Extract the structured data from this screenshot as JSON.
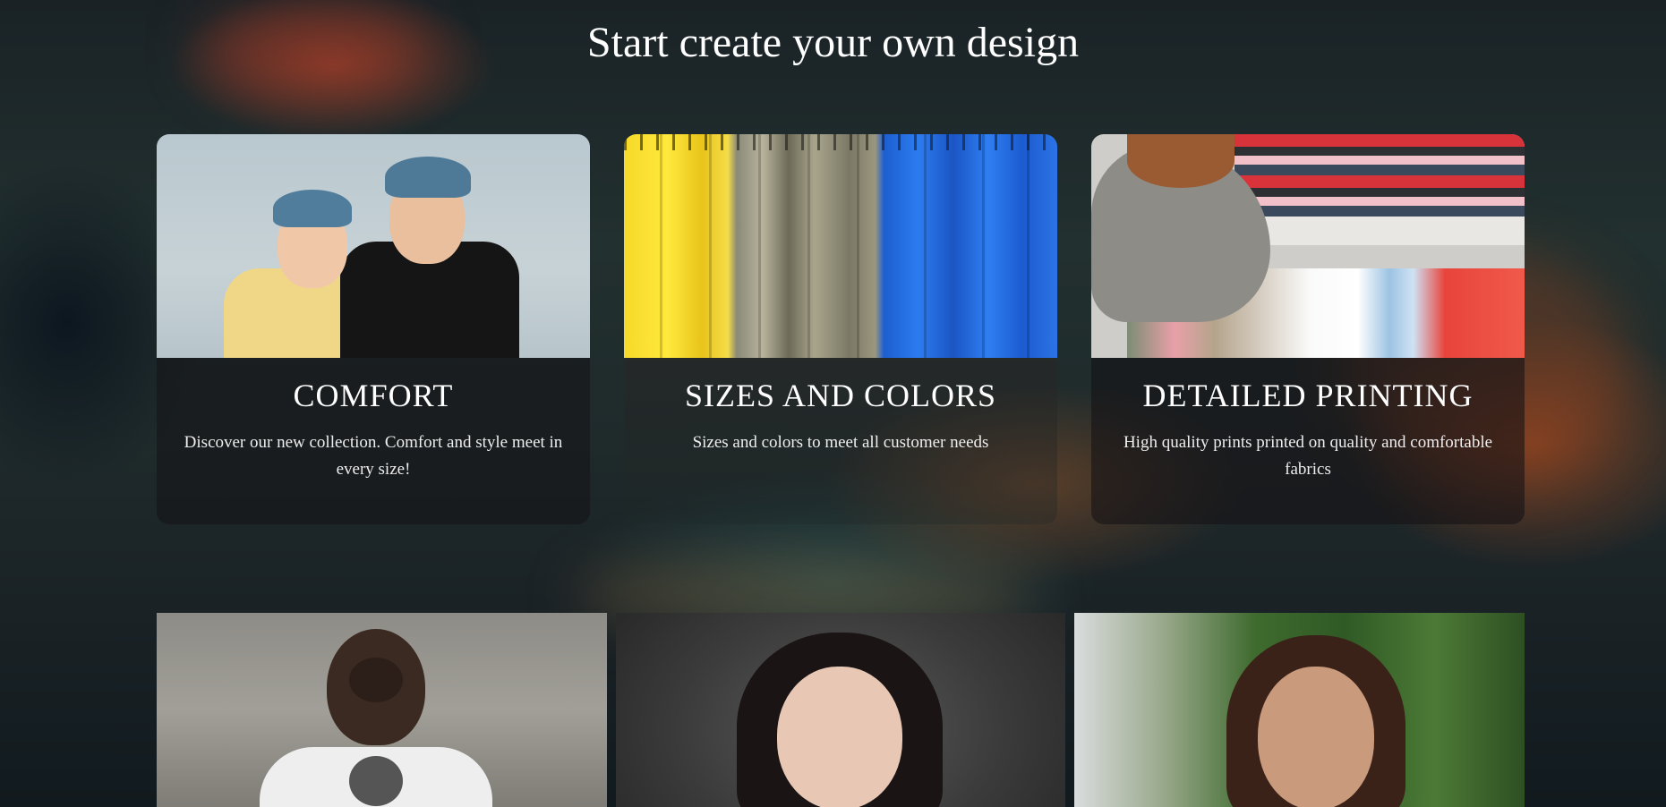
{
  "page": {
    "title": "Start create your own design"
  },
  "features": [
    {
      "title": "COMFORT",
      "text": "Discover our new collection. Comfort and style meet in every size!",
      "image": "kids-in-caps-photo"
    },
    {
      "title": "SIZES AND COLORS",
      "text": "Sizes and colors to meet all customer needs",
      "image": "tshirt-rack-photo"
    },
    {
      "title": "DETAILED PRINTING",
      "text": "High quality prints printed on quality and comfortable fabrics",
      "image": "shop-shelves-photo"
    }
  ],
  "gallery": [
    {
      "image": "woman-back-printed-tee-photo"
    },
    {
      "image": "woman-dark-hair-portrait-photo"
    },
    {
      "image": "woman-garden-portrait-photo"
    }
  ],
  "colors": {
    "text": "#ffffff",
    "body_text": "#eeeeee",
    "yellow_shirt": "#efd787",
    "blue_shirts": "#2c7cf0"
  }
}
